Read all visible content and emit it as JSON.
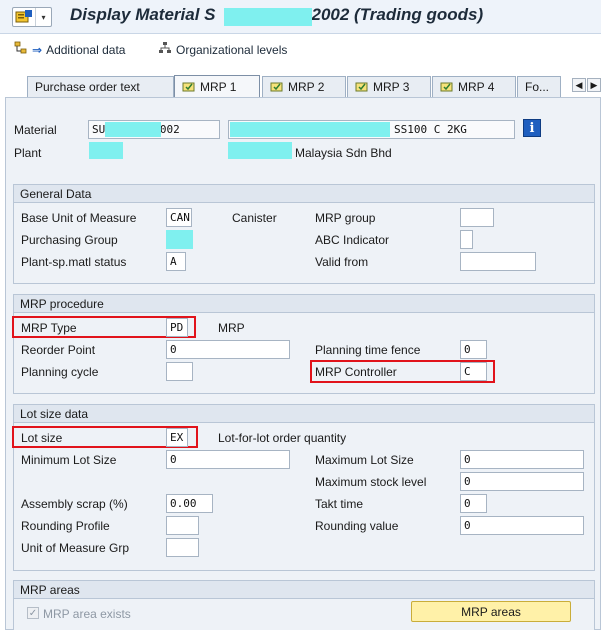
{
  "window": {
    "title_prefix": "Display Material S",
    "title_suffix": "2002 (Trading goods)"
  },
  "toolbar": {
    "additional_data": "Additional data",
    "org_levels": "Organizational levels"
  },
  "tabs": [
    {
      "label": "Purchase order text",
      "active": false
    },
    {
      "label": "MRP 1",
      "active": true
    },
    {
      "label": "MRP 2",
      "active": false
    },
    {
      "label": "MRP 3",
      "active": false
    },
    {
      "label": "MRP 4",
      "active": false
    },
    {
      "label": "Fo...",
      "active": false
    }
  ],
  "header": {
    "material_label": "Material",
    "material_value_prefix": "SU",
    "material_value_suffix": "2002",
    "material_desc_suffix": "SS100 C 2KG",
    "plant_label": "Plant",
    "plant_desc_suffix": "Malaysia Sdn Bhd"
  },
  "general_data": {
    "title": "General Data",
    "base_uom_label": "Base Unit of Measure",
    "base_uom_value": "CAN",
    "base_uom_text": "Canister",
    "purch_group_label": "Purchasing Group",
    "plant_status_label": "Plant-sp.matl status",
    "plant_status_value": "A",
    "mrp_group_label": "MRP group",
    "abc_label": "ABC Indicator",
    "valid_from_label": "Valid from"
  },
  "mrp_procedure": {
    "title": "MRP procedure",
    "mrp_type_label": "MRP Type",
    "mrp_type_value": "PD",
    "mrp_type_text": "MRP",
    "reorder_label": "Reorder Point",
    "reorder_value": "0",
    "planning_cycle_label": "Planning cycle",
    "ptf_label": "Planning time fence",
    "ptf_value": "0",
    "controller_label": "MRP Controller",
    "controller_value": "C"
  },
  "lot_size_data": {
    "title": "Lot size data",
    "lot_size_label": "Lot size",
    "lot_size_value": "EX",
    "lot_size_text": "Lot-for-lot order quantity",
    "min_lot_label": "Minimum Lot Size",
    "min_lot_value": "0",
    "max_lot_label": "Maximum Lot Size",
    "max_lot_value": "0",
    "max_stock_label": "Maximum stock level",
    "max_stock_value": "0",
    "assembly_scrap_label": "Assembly scrap (%)",
    "assembly_scrap_value": "0.00",
    "takt_label": "Takt time",
    "takt_value": "0",
    "rounding_profile_label": "Rounding Profile",
    "rounding_value_label": "Rounding value",
    "rounding_value_value": "0",
    "uom_grp_label": "Unit of Measure Grp"
  },
  "mrp_areas": {
    "title": "MRP areas",
    "exists_label": "MRP area exists",
    "exists_checked": true,
    "button_label": "MRP areas"
  },
  "colors": {
    "highlight": "#e1131b",
    "mask": "#7ff0ef",
    "button": "#fff1a8"
  }
}
